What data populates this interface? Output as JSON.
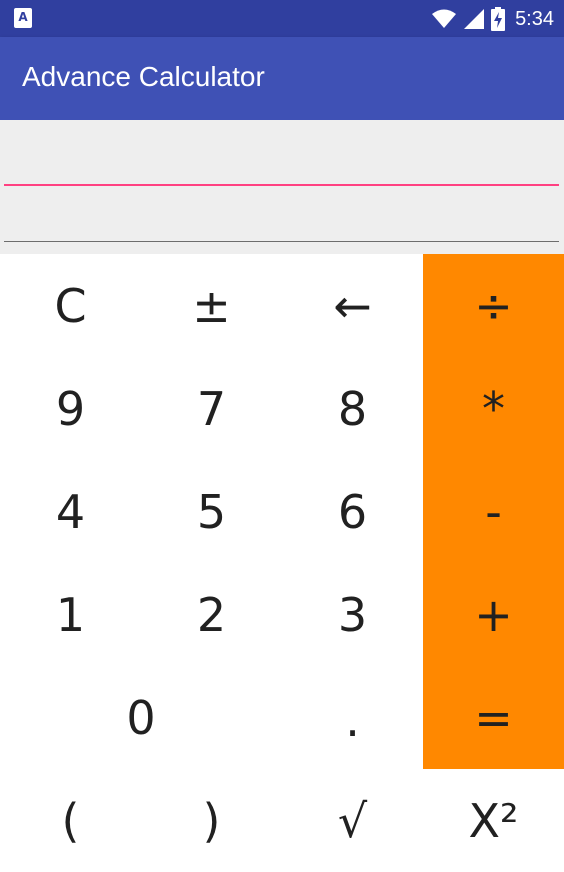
{
  "status_bar": {
    "notification_icon": "A",
    "time": "5:34",
    "icons": [
      "wifi-icon",
      "signal-icon",
      "battery-charging-icon"
    ]
  },
  "app_bar": {
    "title": "Advance Calculator"
  },
  "display": {
    "expression_value": "",
    "result_value": ""
  },
  "keypad": {
    "rows": [
      [
        "C",
        "±",
        "←",
        "÷"
      ],
      [
        "9",
        "7",
        "8",
        "*"
      ],
      [
        "4",
        "5",
        "6",
        "-"
      ],
      [
        "1",
        "2",
        "3",
        "+"
      ],
      [
        "0",
        ".",
        "="
      ],
      [
        "(",
        ")",
        "√",
        "X²"
      ]
    ]
  },
  "colors": {
    "status_bar": "#303f9f",
    "app_bar": "#3f51b5",
    "display_bg": "#eeeeee",
    "operator_bg": "#ff8800",
    "input_underline": "#ff4081"
  }
}
